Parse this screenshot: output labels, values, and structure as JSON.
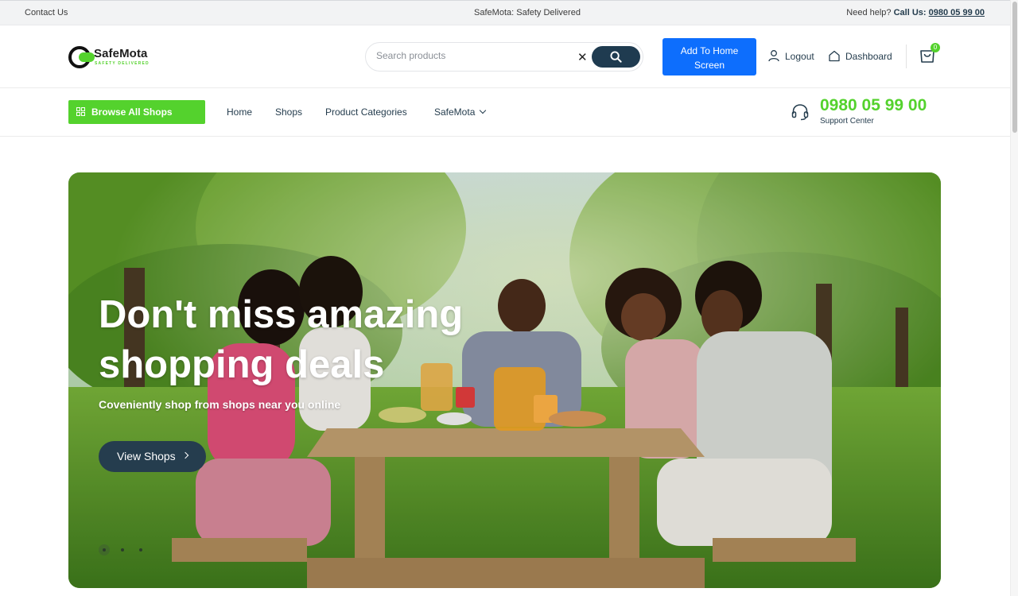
{
  "topbar": {
    "contact": "Contact Us",
    "tagline": "SafeMota: Safety Delivered",
    "help_prefix": "Need help?",
    "call_label": "Call Us:",
    "phone": "0980 05 99 00"
  },
  "header": {
    "logo_name": "SafeMota",
    "logo_tagline": "SAFETY DELIVERED",
    "search_placeholder": "Search products",
    "add_home_line1": "Add To Home",
    "add_home_line2": "Screen",
    "logout": "Logout",
    "dashboard": "Dashboard",
    "cart_count": "0"
  },
  "nav": {
    "browse": "Browse All Shops",
    "items": [
      "Home",
      "Shops",
      "Product Categories",
      "SafeMota"
    ],
    "support_phone": "0980 05 99 00",
    "support_label": "Support Center"
  },
  "hero": {
    "title": "Don't miss amazing shopping deals",
    "subtitle": "Coveniently shop from shops near you online",
    "cta": "View Shops",
    "slides": 3,
    "active_slide": 1
  },
  "colors": {
    "brand_green": "#54d22d",
    "navy": "#253d4e",
    "blue": "#0d6efd"
  },
  "icons": [
    "search-icon",
    "close-icon",
    "user-icon",
    "home-icon",
    "cart-icon",
    "grid-icon",
    "headset-icon",
    "chevron-down-icon",
    "chevron-right-icon"
  ]
}
